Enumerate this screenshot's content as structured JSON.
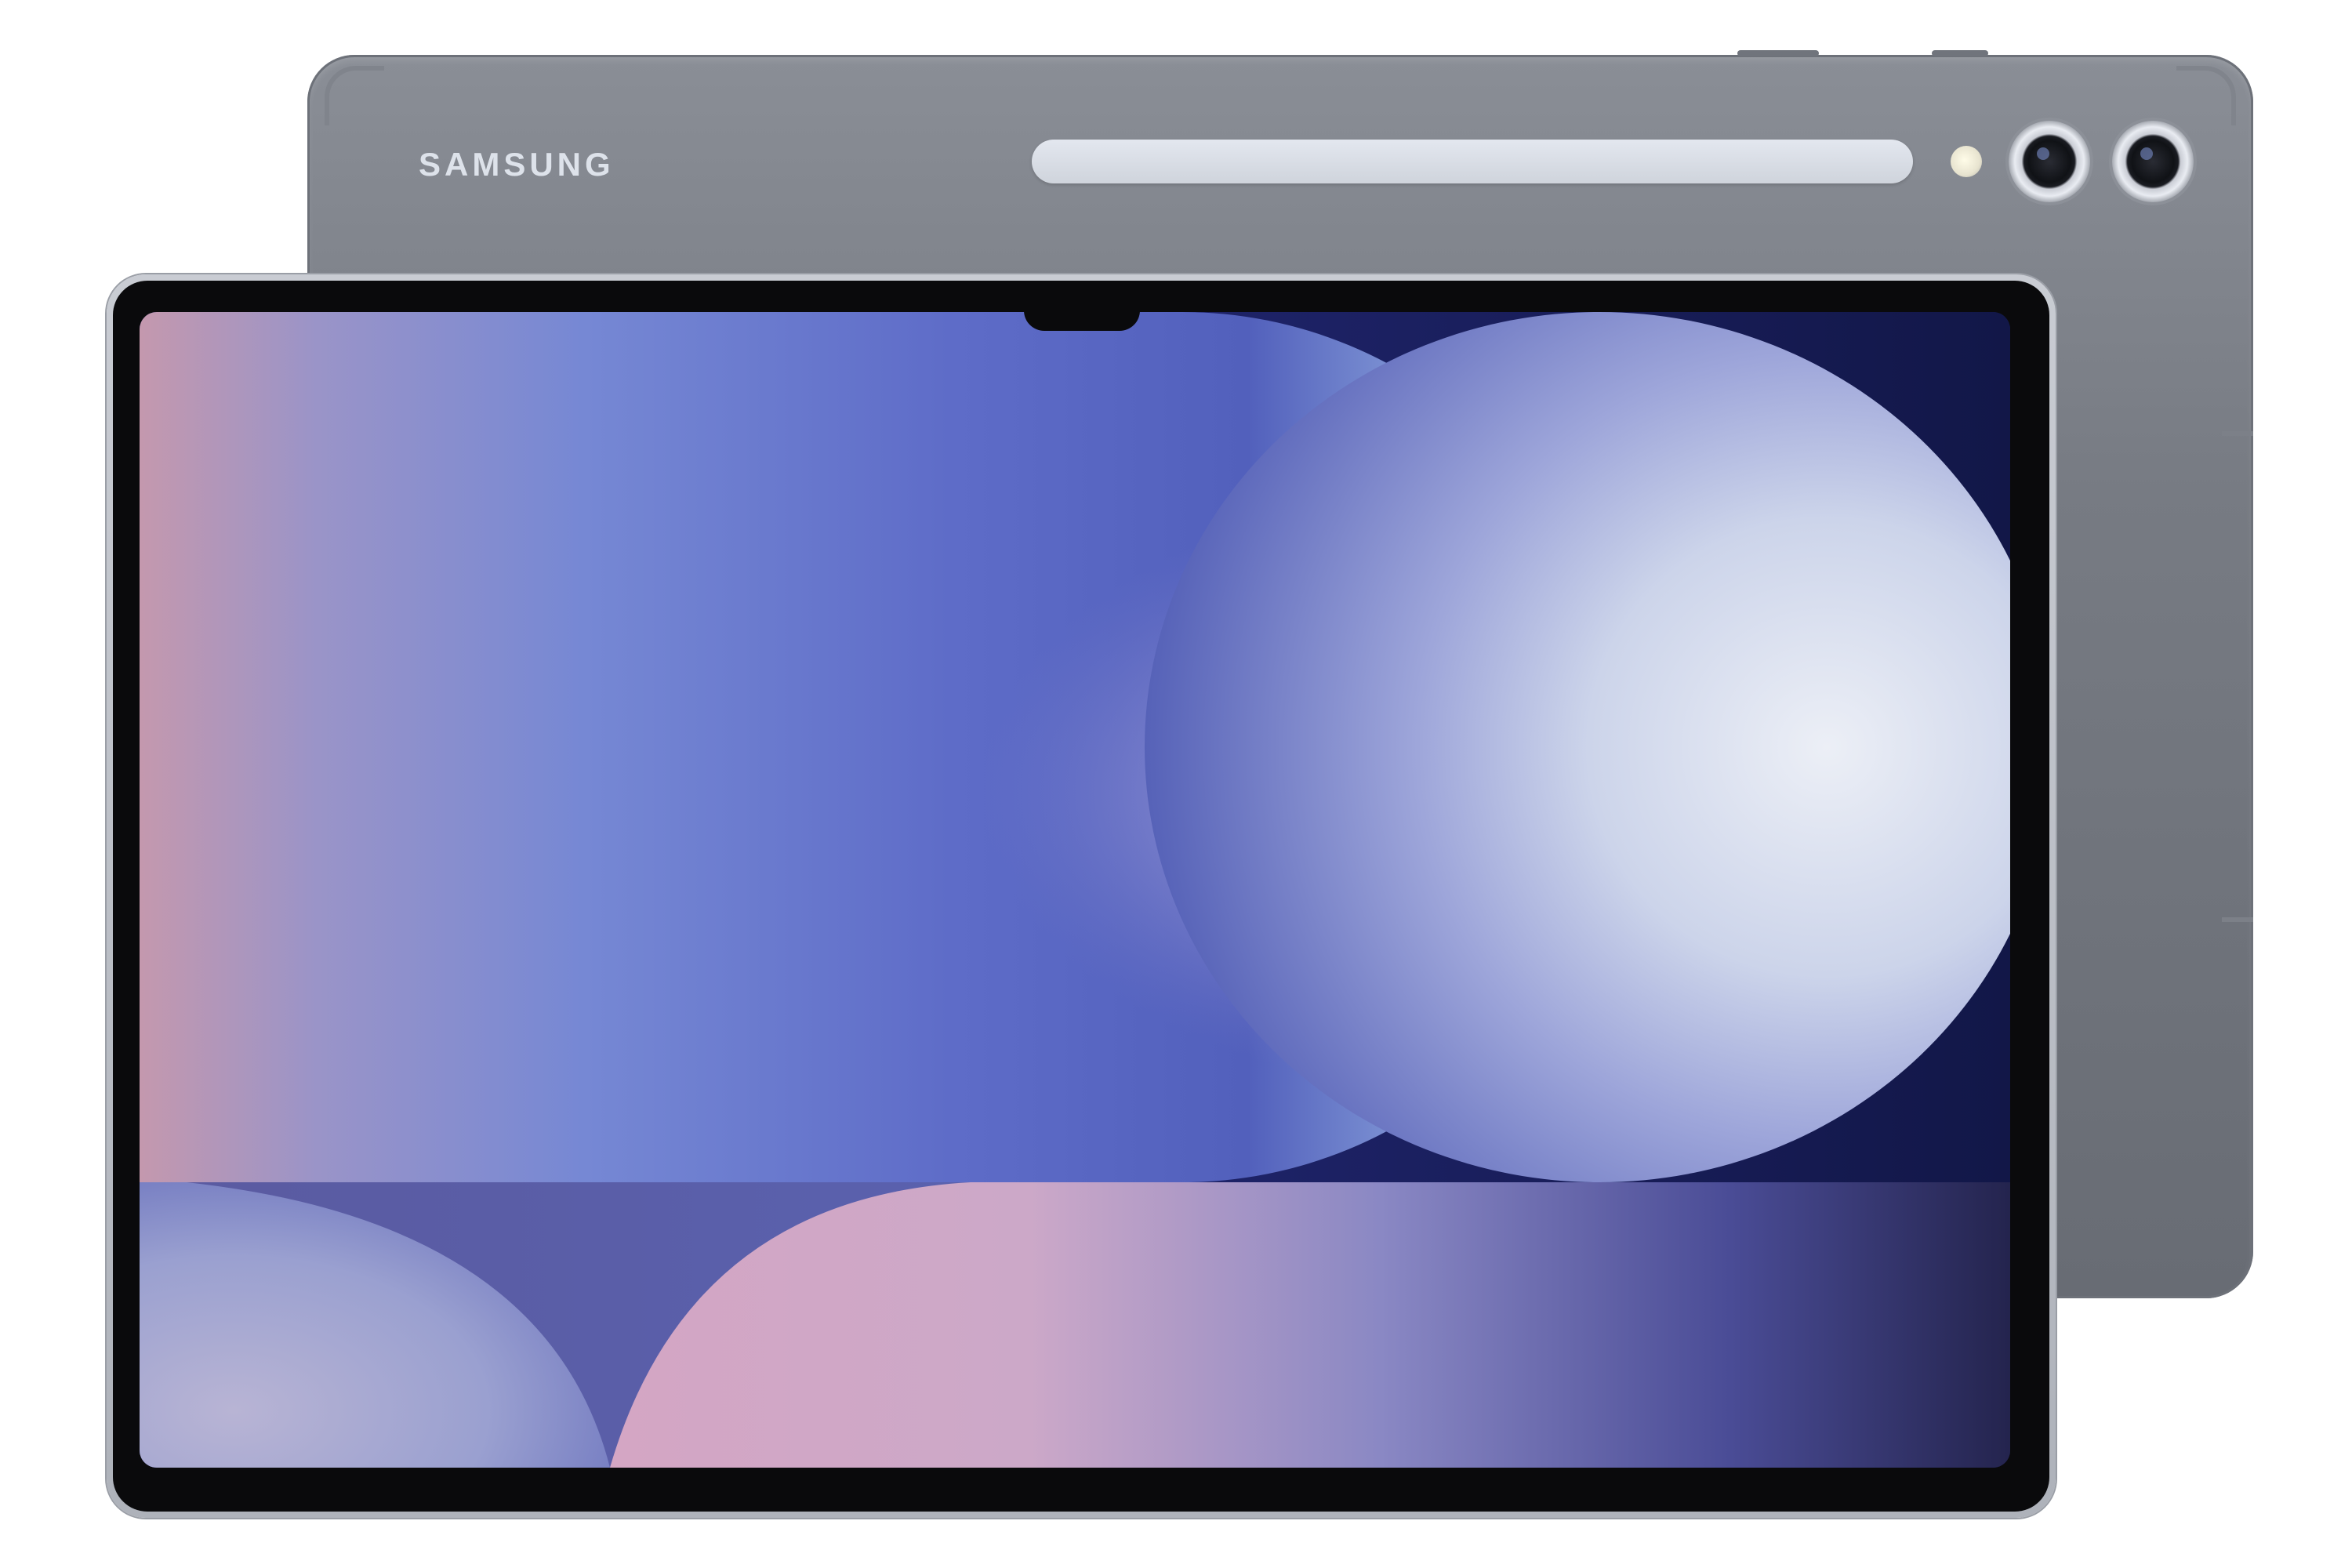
{
  "device": {
    "brand_logo": "SAMSUNG",
    "colors": {
      "body": "#7a7e86",
      "frame": "#b5b9c1",
      "bezel": "#0a0a0c",
      "wallpaper_dark": "#1b2062",
      "wallpaper_mid": "#5a68c6",
      "wallpaper_light": "#dde4f2",
      "wallpaper_pink": "#d8a8c8"
    },
    "icons": {
      "rear_camera_1": "camera-lens-icon",
      "rear_camera_2": "camera-lens-icon",
      "flash": "flash-icon",
      "front_camera": "front-camera-icon"
    }
  }
}
